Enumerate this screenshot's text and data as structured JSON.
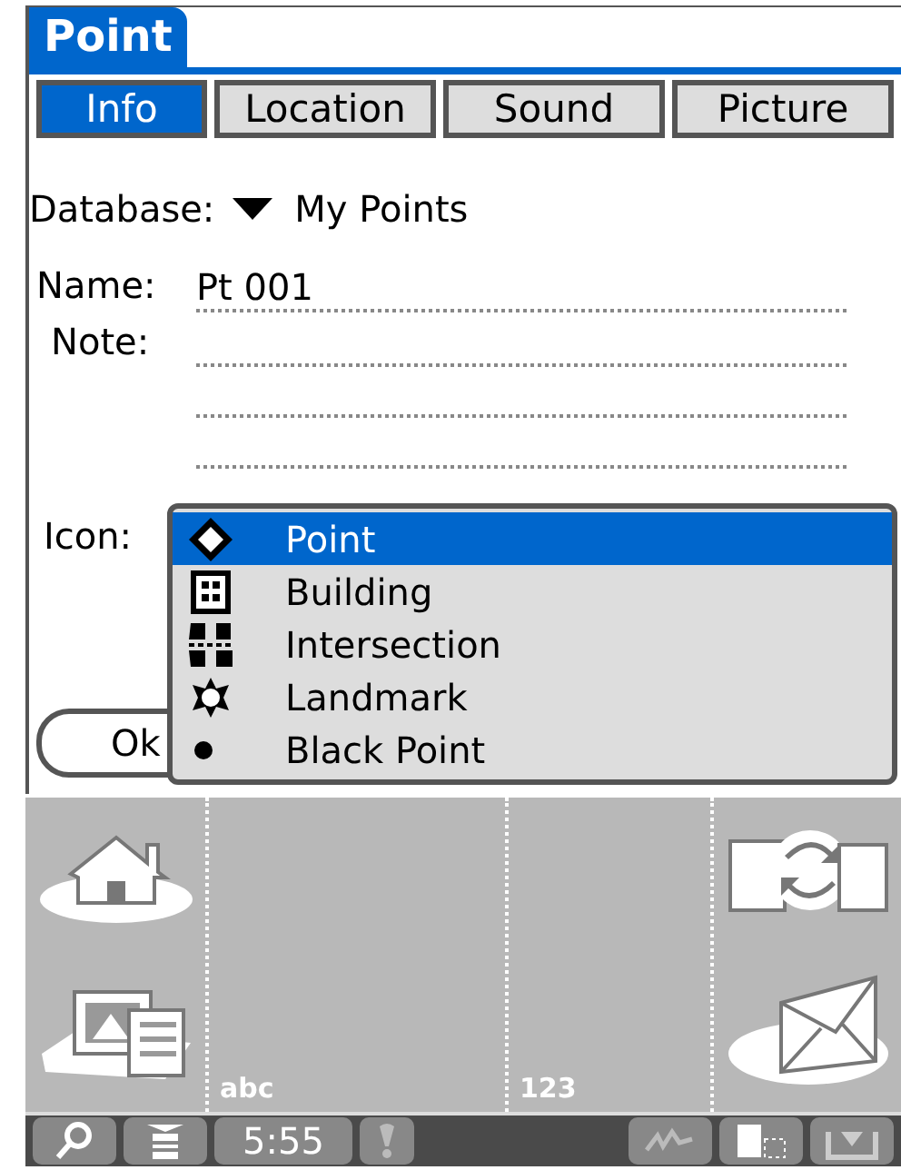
{
  "title": "Point",
  "tabs": [
    {
      "label": "Info",
      "selected": true
    },
    {
      "label": "Location",
      "selected": false
    },
    {
      "label": "Sound",
      "selected": false
    },
    {
      "label": "Picture",
      "selected": false
    }
  ],
  "database": {
    "label": "Database:",
    "value": "My Points"
  },
  "name": {
    "label": "Name:",
    "value": "Pt 001"
  },
  "note": {
    "label": "Note:"
  },
  "icon": {
    "label": "Icon:"
  },
  "ok_button": "Ok",
  "icon_list": [
    {
      "kind": "point",
      "label": "Point",
      "selected": true
    },
    {
      "kind": "building",
      "label": "Building",
      "selected": false
    },
    {
      "kind": "intersection",
      "label": "Intersection",
      "selected": false
    },
    {
      "kind": "landmark",
      "label": "Landmark",
      "selected": false
    },
    {
      "kind": "black_point",
      "label": "Black Point",
      "selected": false
    }
  ],
  "graffiti": {
    "letters_label": "abc",
    "numbers_label": "123"
  },
  "status_bar": {
    "time": "5:55"
  }
}
